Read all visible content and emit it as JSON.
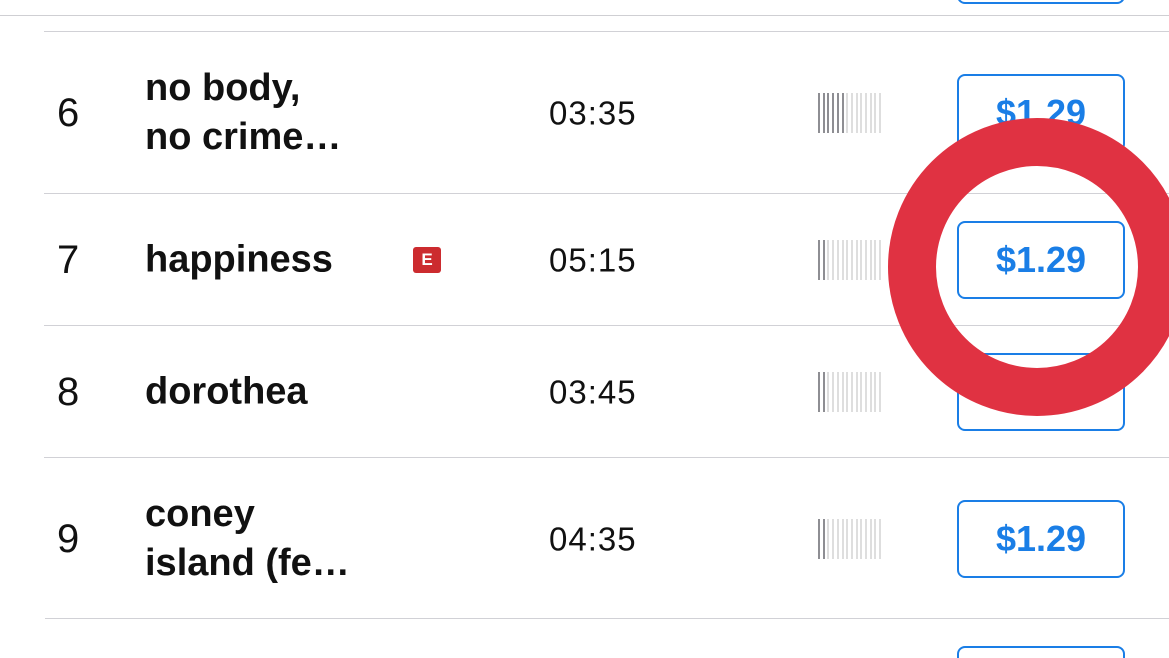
{
  "tracks": [
    {
      "number": "6",
      "title": "no body,\nno crime…",
      "explicit": false,
      "duration": "03:35",
      "popularity": 0.45,
      "price": "$1.29"
    },
    {
      "number": "7",
      "title": "happiness",
      "explicit": true,
      "explicit_label": "E",
      "duration": "05:15",
      "popularity": 0.15,
      "price": "$1.29"
    },
    {
      "number": "8",
      "title": "dorothea",
      "explicit": false,
      "duration": "03:45",
      "popularity": 0.15,
      "price": "$1.29"
    },
    {
      "number": "9",
      "title": "coney\nisland (fe…",
      "explicit": false,
      "duration": "04:35",
      "popularity": 0.15,
      "price": "$1.29"
    }
  ],
  "colors": {
    "accent": "#1a7ee6",
    "explicit_badge": "#cc2b2f",
    "highlight_ring": "#e03242"
  },
  "highlight": {
    "target": "track-7-price-button"
  }
}
